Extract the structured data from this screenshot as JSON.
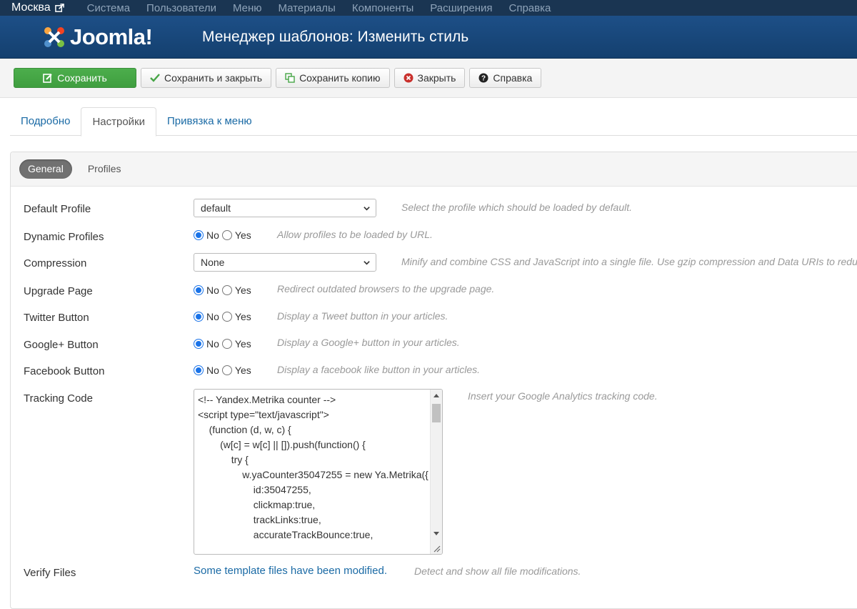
{
  "topnav": {
    "site": "Москва",
    "items": [
      "Система",
      "Пользователи",
      "Меню",
      "Материалы",
      "Компоненты",
      "Расширения",
      "Справка"
    ]
  },
  "header": {
    "logo_text": "Joomla!",
    "title": "Менеджер шаблонов: Изменить стиль"
  },
  "toolbar": {
    "save": "Сохранить",
    "save_close": "Сохранить и закрыть",
    "save_copy": "Сохранить копию",
    "close": "Закрыть",
    "help": "Справка"
  },
  "tabs": [
    "Подробно",
    "Настройки",
    "Привязка к меню"
  ],
  "subtabs": [
    "General",
    "Profiles"
  ],
  "fields": {
    "default_profile": {
      "label": "Default Profile",
      "value": "default",
      "help": "Select the profile which should be loaded by default."
    },
    "dynamic_profiles": {
      "label": "Dynamic Profiles",
      "help": "Allow profiles to be loaded by URL."
    },
    "compression": {
      "label": "Compression",
      "value": "None",
      "help": "Minify and combine CSS and JavaScript into a single file. Use gzip compression and Data URIs to reduce"
    },
    "upgrade_page": {
      "label": "Upgrade Page",
      "help": "Redirect outdated browsers to the upgrade page."
    },
    "twitter_button": {
      "label": "Twitter Button",
      "help": "Display a Tweet button in your articles."
    },
    "google_button": {
      "label": "Google+ Button",
      "help": "Display a Google+ button in your articles."
    },
    "facebook_button": {
      "label": "Facebook Button",
      "help": "Display a facebook like button in your articles."
    },
    "tracking_code": {
      "label": "Tracking Code",
      "help": "Insert your Google Analytics tracking code.",
      "value": "<!-- Yandex.Metrika counter -->\n<script type=\"text/javascript\">\n    (function (d, w, c) {\n        (w[c] = w[c] || []).push(function() {\n            try {\n                w.yaCounter35047255 = new Ya.Metrika({\n                    id:35047255,\n                    clickmap:true,\n                    trackLinks:true,\n                    accurateTrackBounce:true,"
    },
    "verify_files": {
      "label": "Verify Files",
      "link": "Some template files have been modified.",
      "help": "Detect and show all file modifications."
    }
  },
  "radio": {
    "no": "No",
    "yes": "Yes"
  },
  "colors": {
    "topnav": "#1a3552",
    "header": "#1d4f87",
    "primary": "#46a546",
    "link": "#1a6aa5"
  }
}
